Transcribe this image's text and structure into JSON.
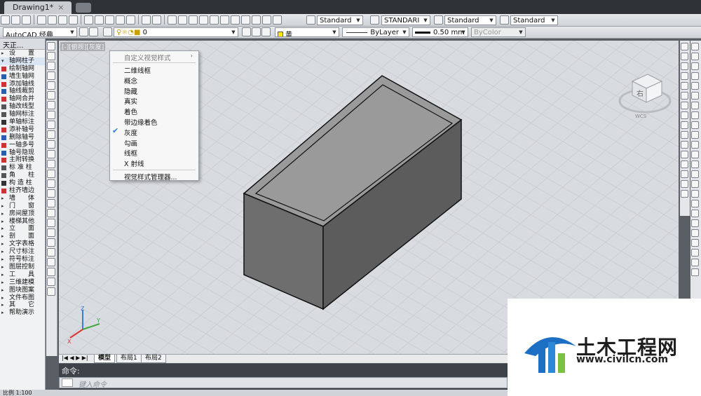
{
  "window": {
    "tab_title": "Drawing1*"
  },
  "toolbar2": {
    "workspace": "AutoCAD 经典",
    "layer": "0",
    "text_style": "Standard",
    "dim_style": "STANDARI",
    "table_style": "Standard",
    "mleader_style": "Standard",
    "color": "黄",
    "linetype": "ByLayer",
    "lineweight": "0.50 mm",
    "plotstyle": "ByColor"
  },
  "left_palette": {
    "title": "天正...",
    "items": [
      "设　　置",
      "轴网柱子",
      "绘制轴网",
      "墙生轴网",
      "添加轴线",
      "轴线裁剪",
      "轴网合并",
      "轴改线型",
      "轴网标注",
      "单轴标注",
      "添补轴号",
      "删除轴号",
      "一轴多号",
      "轴号隐现",
      "主附转换",
      "标 准 柱",
      "角　　柱",
      "构 造 柱",
      "柱齐墙边",
      "墙　　体",
      "门　　窗",
      "房间屋顶",
      "楼梯其他",
      "立　　面",
      "剖　　面",
      "文字表格",
      "尺寸标注",
      "符号标注",
      "图层控制",
      "工　　具",
      "三维建模",
      "图块图案",
      "文件布图",
      "其　　它",
      "帮助演示"
    ]
  },
  "viewport": {
    "label": "[-][俯视][灰度]",
    "viewcube_face": "右",
    "wcs": "WCS"
  },
  "visual_style_menu": {
    "header": "自定义视觉样式",
    "items": [
      "二维线框",
      "概念",
      "隐藏",
      "真实",
      "着色",
      "带边缘着色",
      "灰度",
      "勾画",
      "线框",
      "X 射线"
    ],
    "checked": "灰度",
    "manager": "视觉样式管理器..."
  },
  "layout_tabs": [
    "模型",
    "布局1",
    "布局2"
  ],
  "command": {
    "label": "命令:",
    "placeholder": "键入命令"
  },
  "status": {
    "scale": "比例 1:100"
  },
  "watermark": {
    "title": "土木工程网",
    "url": "www.civilcn.com"
  },
  "colors": {
    "box_top": "#9a9a9a",
    "box_front": "#6e6e6e",
    "box_side": "#5c5c5c",
    "grid": "#c7cacf",
    "accent": "#2d7fd3"
  }
}
